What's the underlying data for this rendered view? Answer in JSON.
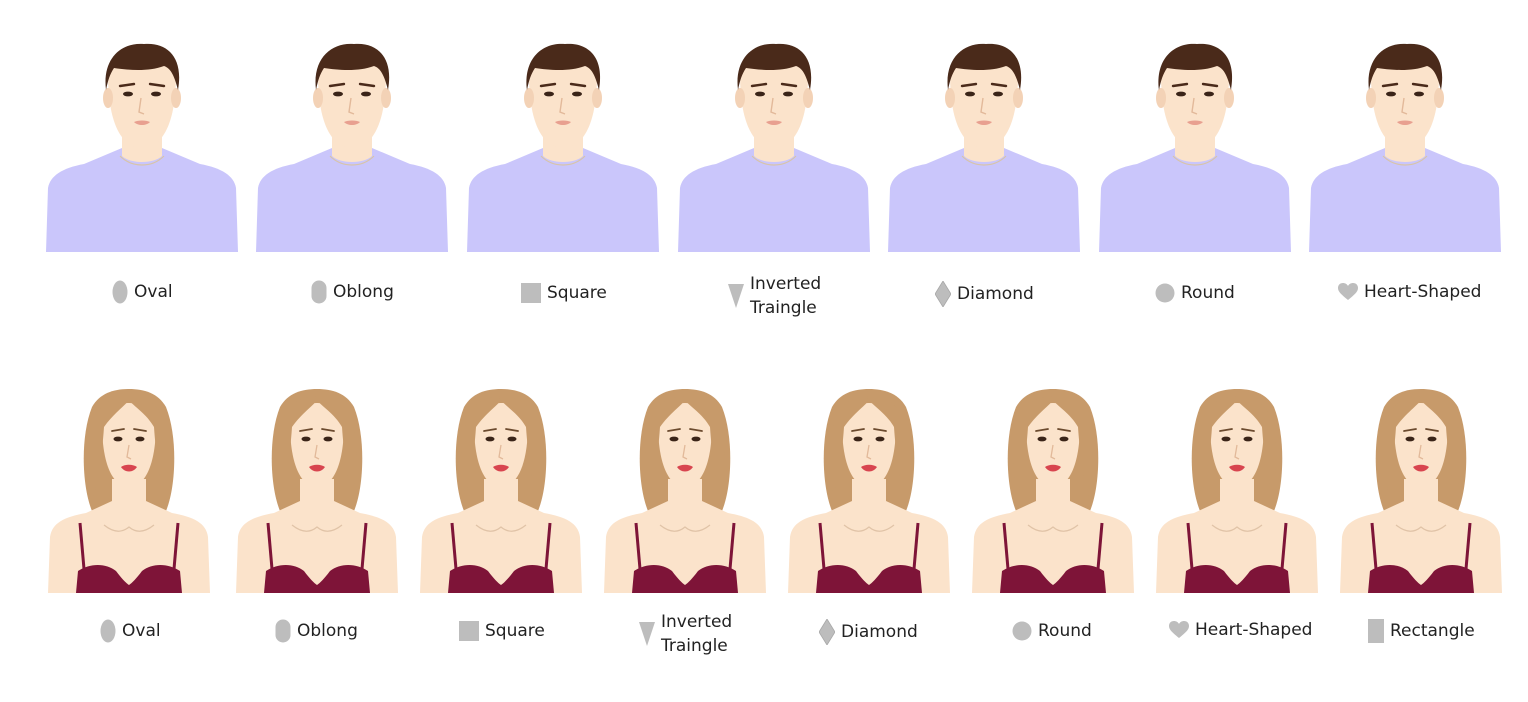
{
  "men": {
    "labels": [
      "Oval",
      "Oblong",
      "Square",
      "Inverted\nTraingle",
      "Diamond",
      "Round",
      "Heart-Shaped"
    ],
    "icons": [
      "oval-icon",
      "oblong-icon",
      "square-icon",
      "inverted-triangle-icon",
      "diamond-icon",
      "round-icon",
      "heart-icon"
    ]
  },
  "women": {
    "labels": [
      "Oval",
      "Oblong",
      "Square",
      "Inverted\nTraingle",
      "Diamond",
      "Round",
      "Heart-Shaped",
      "Rectangle"
    ],
    "icons": [
      "oval-icon",
      "oblong-icon",
      "square-icon",
      "inverted-triangle-icon",
      "diamond-icon",
      "round-icon",
      "heart-icon",
      "rectangle-icon"
    ]
  },
  "colors": {
    "skin": "#fbe3cb",
    "male_hair": "#4a2a1a",
    "male_shirt": "#cac6fb",
    "female_hair": "#c79a6a",
    "female_bra": "#7e1438",
    "shape_icon": "#bdbdbd",
    "lips_male": "#e8a090",
    "lips_female": "#d8454f"
  }
}
